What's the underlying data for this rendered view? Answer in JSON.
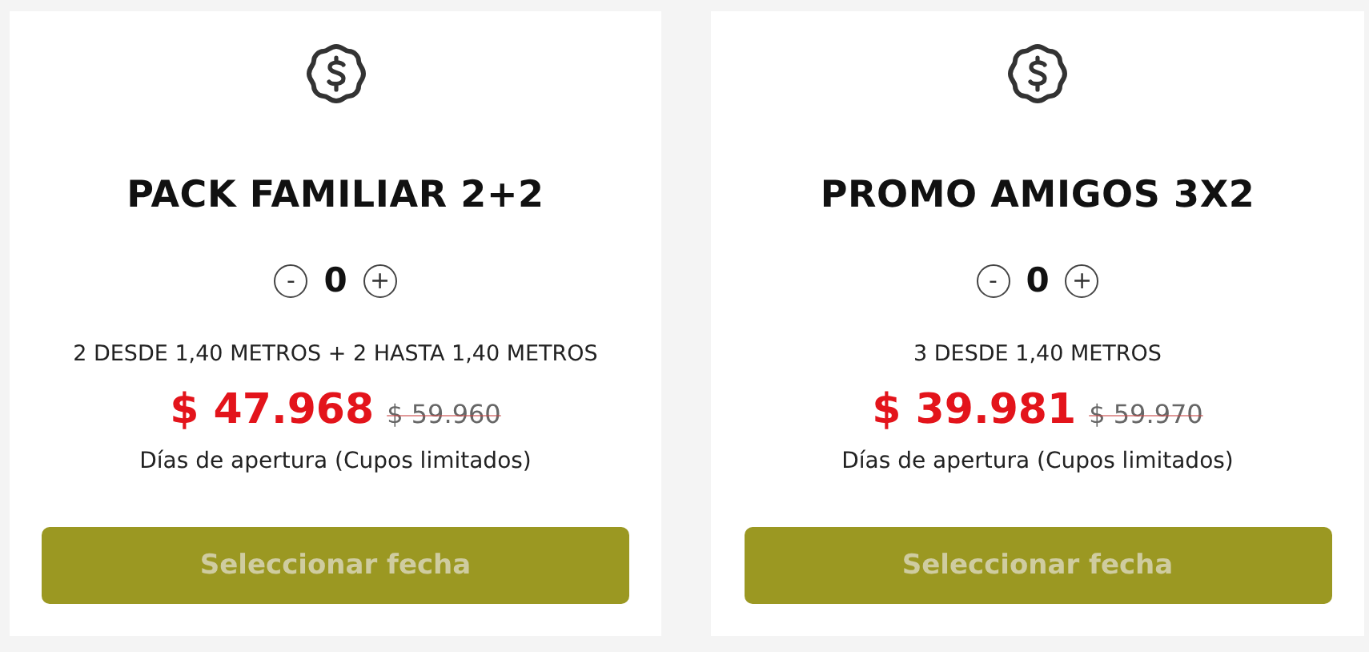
{
  "cards": [
    {
      "title": "PACK FAMILIAR 2+2",
      "minus": "-",
      "quantity": "0",
      "plus": "+",
      "description": "2 DESDE 1,40 METROS + 2 HASTA 1,40 METROS",
      "price": "$ 47.968",
      "old_price": "$ 59.960",
      "note": "Días de apertura (Cupos limitados)",
      "button": {
        "label": "Seleccionar fecha",
        "disabled": true
      }
    },
    {
      "title": "PROMO AMIGOS 3X2",
      "minus": "-",
      "quantity": "0",
      "plus": "+",
      "description": "3 DESDE 1,40 METROS",
      "price": "$ 39.981",
      "old_price": "$ 59.970",
      "note": "Días de apertura (Cupos limitados)",
      "button": {
        "label": "Seleccionar fecha",
        "disabled": true
      }
    }
  ]
}
